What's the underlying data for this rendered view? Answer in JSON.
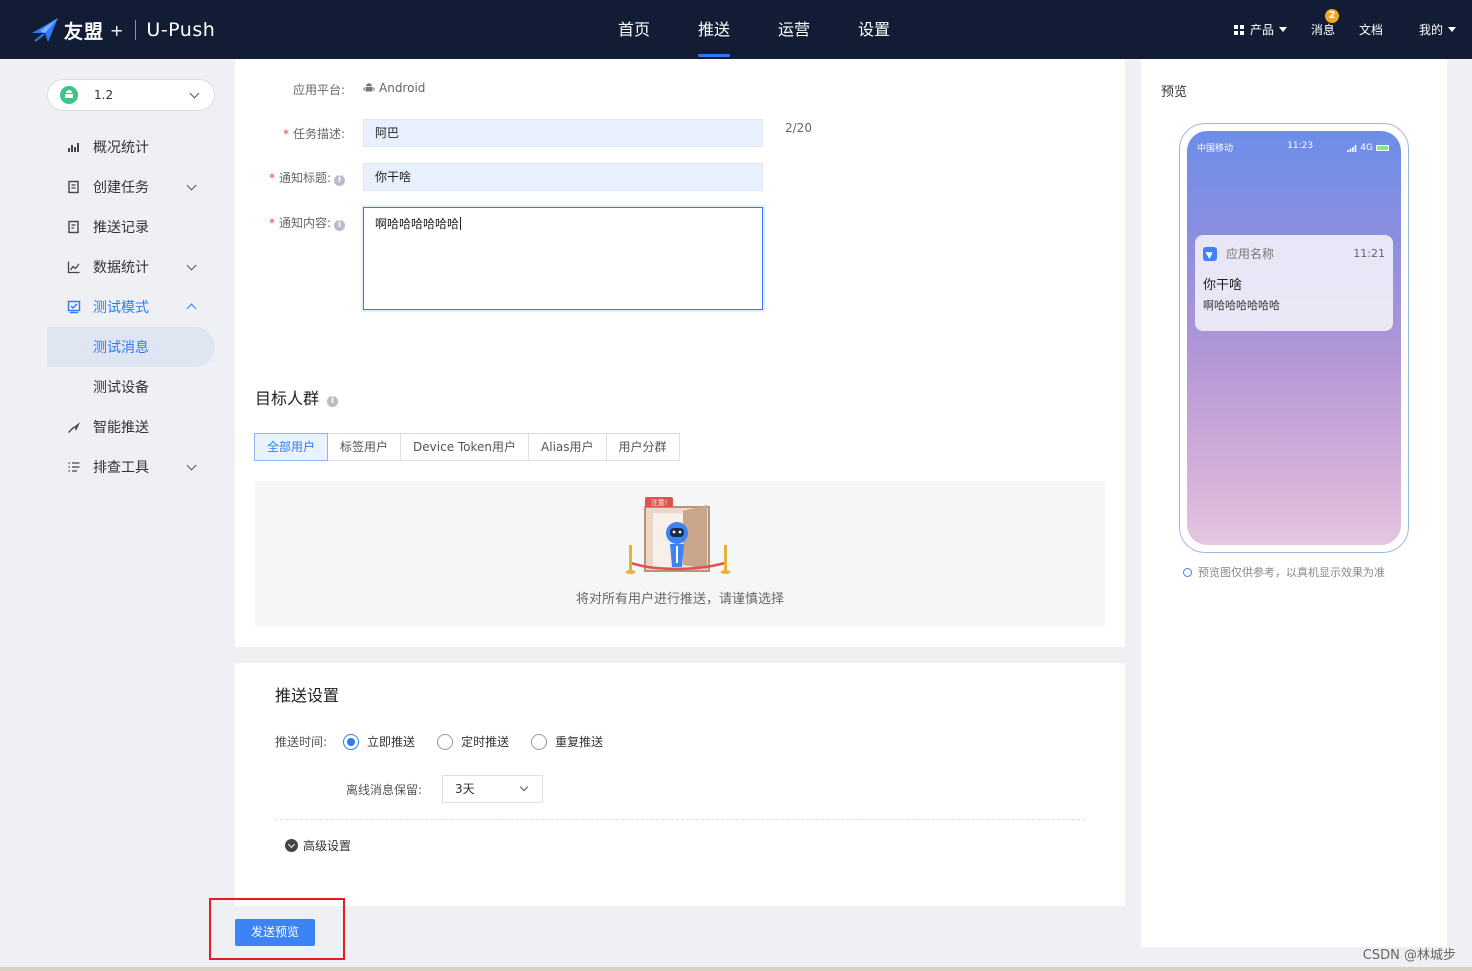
{
  "topbar": {
    "brand": "友盟",
    "brand_plus": "+",
    "product": "U-Push",
    "nav": [
      "首页",
      "推送",
      "运营",
      "设置"
    ],
    "active_nav": "推送",
    "right": {
      "products": "产品",
      "messages": "消息",
      "message_count": "2",
      "docs": "文档",
      "mine": "我的"
    }
  },
  "sidebar": {
    "version": "1.2",
    "items": [
      {
        "label": "概况统计",
        "icon": "chart-icon"
      },
      {
        "label": "创建任务",
        "icon": "task-icon"
      },
      {
        "label": "推送记录",
        "icon": "record-icon"
      },
      {
        "label": "数据统计",
        "icon": "line-chart-icon"
      },
      {
        "label": "测试模式",
        "icon": "test-icon"
      },
      {
        "label": "测试消息"
      },
      {
        "label": "测试设备"
      },
      {
        "label": "智能推送",
        "icon": "smart-push-icon"
      },
      {
        "label": "排查工具",
        "icon": "list-tool-icon"
      }
    ]
  },
  "form": {
    "platform_label": "应用平台:",
    "platform_value": "Android",
    "task_desc_label": "任务描述:",
    "task_desc_value": "阿巴",
    "task_desc_counter": "2/20",
    "title_label": "通知标题:",
    "title_value": "你干啥",
    "content_label": "通知内容:",
    "content_value": "啊哈哈哈哈哈哈"
  },
  "target": {
    "title": "目标人群",
    "tabs": [
      "全部用户",
      "标签用户",
      "Device Token用户",
      "Alias用户",
      "用户分群"
    ],
    "notice": "将对所有用户进行推送，请谨慎选择",
    "sign_text": "注意!"
  },
  "push_settings": {
    "title": "推送设置",
    "time_label": "推送时间:",
    "options": [
      "立即推送",
      "定时推送",
      "重复推送"
    ],
    "selected": 0,
    "offline_label": "离线消息保留:",
    "offline_value": "3天",
    "advanced": "高级设置"
  },
  "send_preview_button": "发送预览",
  "preview": {
    "title": "预览",
    "carrier": "中国移动",
    "status_time": "11:23",
    "network": "4G",
    "app_name": "应用名称",
    "notif_time": "11:21",
    "notif_title": "你干啥",
    "notif_body": "啊哈哈哈哈哈哈",
    "tip": "预览图仅供参考，以真机显示效果为准"
  },
  "watermark": "CSDN @林城步",
  "colors": {
    "nav_bg": "#121d35",
    "accent": "#2b7cf6",
    "required": "#e3483c",
    "highlight_box": "#e02020"
  }
}
